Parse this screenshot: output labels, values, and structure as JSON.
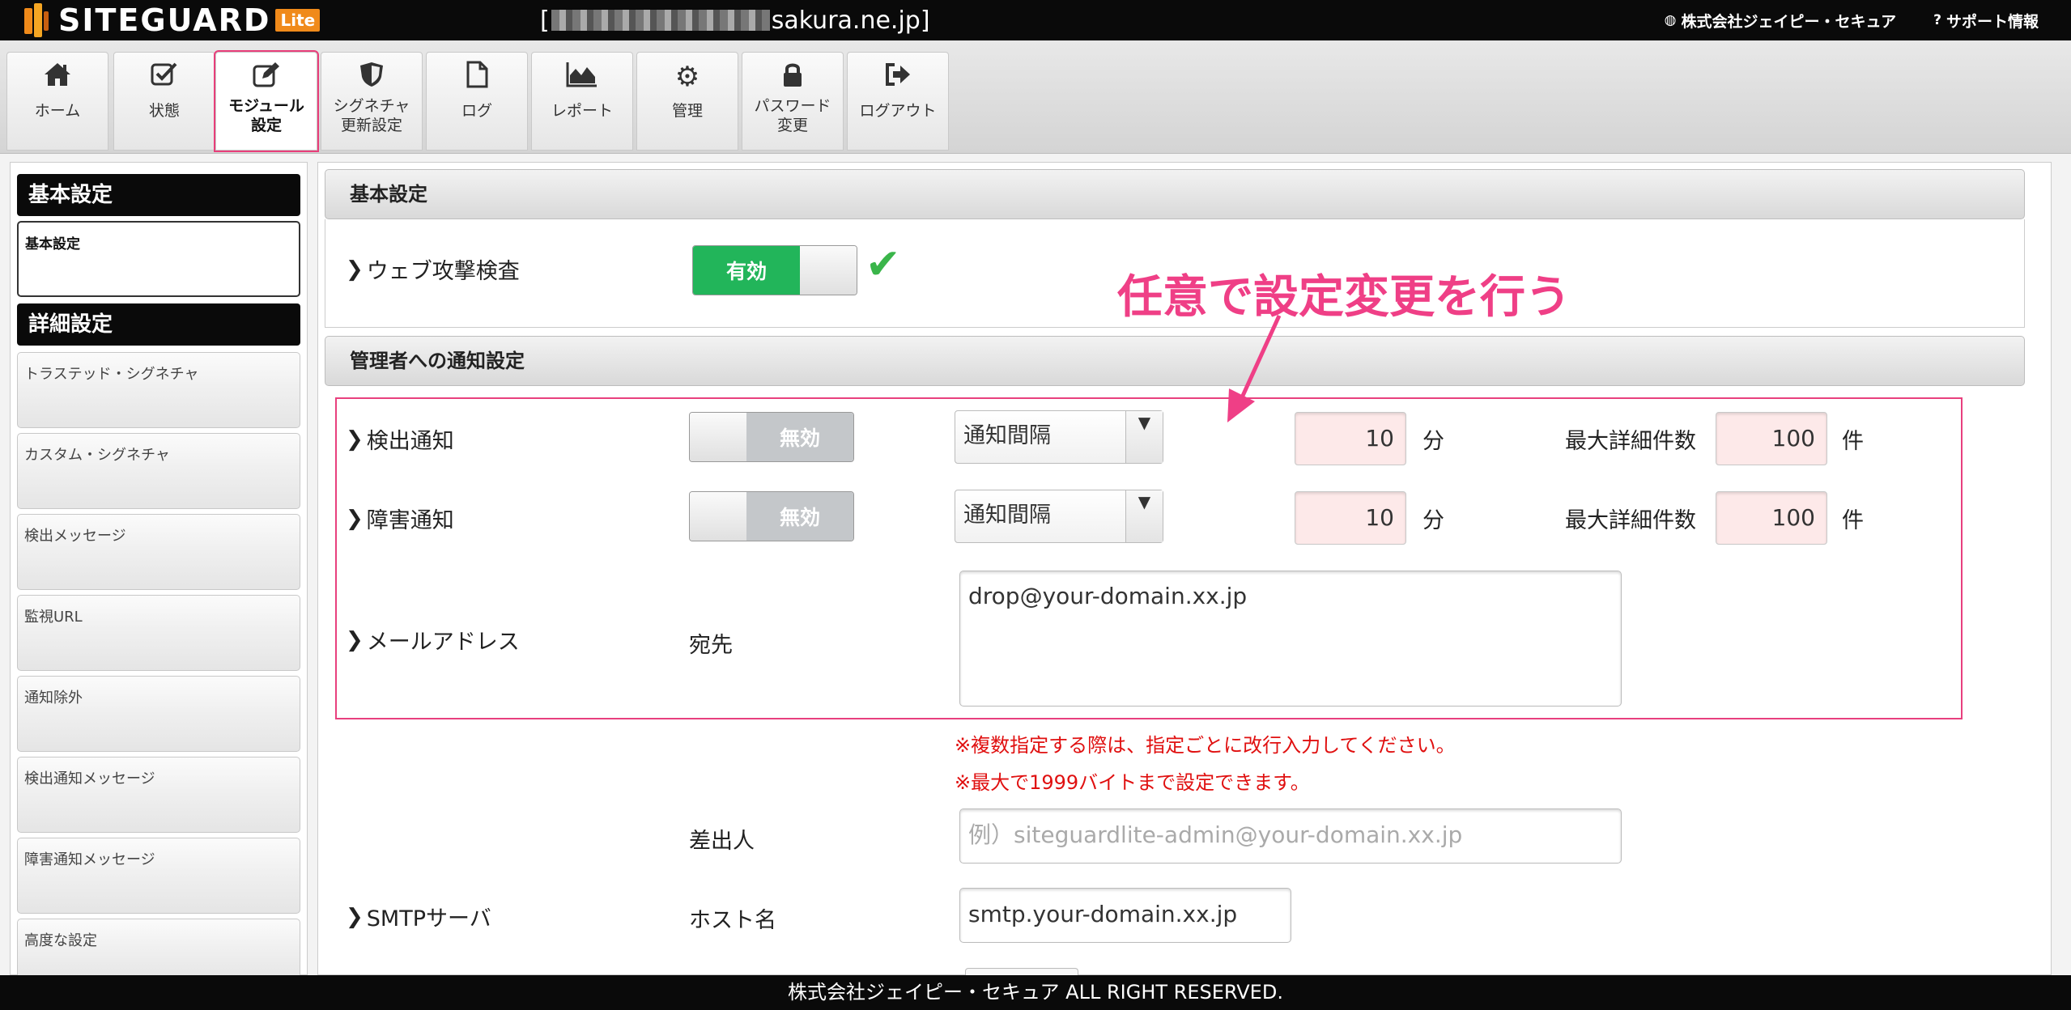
{
  "header": {
    "logo_text": "SITEGUARD",
    "logo_badge": "Lite",
    "domain_suffix": "sakura.ne.jp]",
    "domain_prefix": "[",
    "company_link": "株式会社ジェイピー・セキュア",
    "support_link": "サポート情報"
  },
  "tabs": [
    {
      "label": "ホーム",
      "icon": "home-icon"
    },
    {
      "label": "状態",
      "icon": "checkbox-icon"
    },
    {
      "label1": "モジュール",
      "label2": "設定",
      "icon": "edit-icon"
    },
    {
      "label1": "シグネチャ",
      "label2": "更新設定",
      "icon": "shield-icon"
    },
    {
      "label": "ログ",
      "icon": "document-icon"
    },
    {
      "label": "レポート",
      "icon": "area-chart-icon"
    },
    {
      "label": "管理",
      "icon": "gear-icon"
    },
    {
      "label1": "パスワード",
      "label2": "変更",
      "icon": "lock-icon"
    },
    {
      "label": "ログアウト",
      "icon": "logout-icon"
    }
  ],
  "sidebar": {
    "basic_heading": "基本設定",
    "basic_item": "基本設定",
    "detail_heading": "詳細設定",
    "items": [
      "トラステッド・シグネチャ",
      "カスタム・シグネチャ",
      "検出メッセージ",
      "監視URL",
      "通知除外",
      "検出通知メッセージ",
      "障害通知メッセージ",
      "高度な設定"
    ]
  },
  "main": {
    "basic_panel_title": "基本設定",
    "web_attack_label": "ウェブ攻撃検査",
    "web_attack_state": "有効",
    "notify_panel_title": "管理者への通知設定",
    "detect_label": "検出通知",
    "fault_label": "障害通知",
    "toggle_off_text": "無効",
    "interval_select": "通知間隔",
    "interval_value": "10",
    "interval_unit": "分",
    "max_detail_label": "最大詳細件数",
    "max_detail_value": "100",
    "max_detail_unit": "件",
    "mail_label": "メールアドレス",
    "to_label": "宛先",
    "to_value": "drop@your-domain.xx.jp",
    "note1": "※複数指定する際は、指定ごとに改行入力してください。",
    "note2": "※最大で1999バイトまで設定できます。",
    "from_label": "差出人",
    "from_placeholder": "例）siteguardlite-admin@your-domain.xx.jp",
    "smtp_label": "SMTPサーバ",
    "host_label": "ホスト名",
    "host_value": "smtp.your-domain.xx.jp"
  },
  "annotation": "任意で設定変更を行う",
  "footer": "株式会社ジェイピー・セキュア ALL RIGHT RESERVED.",
  "colors": {
    "accent_pink": "#e8407e",
    "enabled_green": "#22b55a",
    "note_red": "#e01010"
  }
}
